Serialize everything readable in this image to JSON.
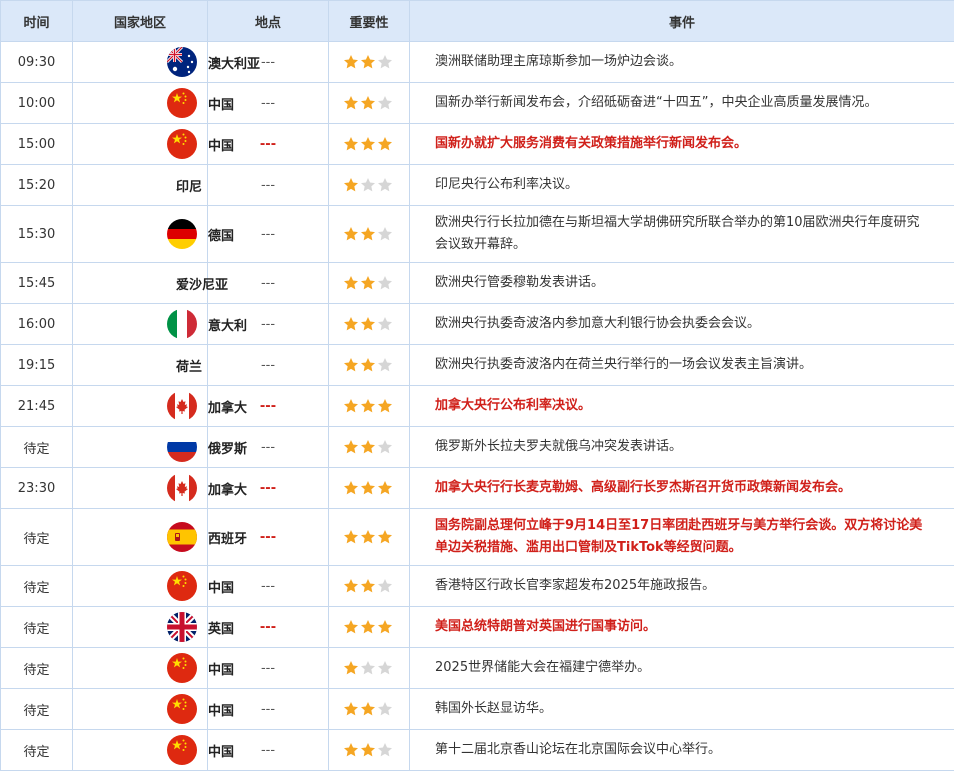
{
  "header": {
    "time": "时间",
    "country": "国家地区",
    "place": "地点",
    "importance": "重要性",
    "event": "事件"
  },
  "colors": {
    "header_bg": "#dbe8f9",
    "border": "#c6d8ee",
    "highlight": "#d0201a",
    "star_on": "#f5a623",
    "star_off": "#d6d6d6"
  },
  "rows": [
    {
      "time": "09:30",
      "flag": "australia-flag-icon",
      "country": "澳大利亚",
      "place": "---",
      "stars": 2,
      "highlight": false,
      "event": "澳洲联储助理主席琼斯参加一场炉边会谈。"
    },
    {
      "time": "10:00",
      "flag": "china-flag-icon",
      "country": "中国",
      "place": "---",
      "stars": 2,
      "highlight": false,
      "event": "国新办举行新闻发布会，介绍砥砺奋进“十四五”，中央企业高质量发展情况。"
    },
    {
      "time": "15:00",
      "flag": "china-flag-icon",
      "country": "中国",
      "place": "---",
      "stars": 3,
      "highlight": true,
      "event": "国新办就扩大服务消费有关政策措施举行新闻发布会。"
    },
    {
      "time": "15:20",
      "flag": "",
      "country": "印尼",
      "place": "---",
      "stars": 1,
      "highlight": false,
      "event": "印尼央行公布利率决议。"
    },
    {
      "time": "15:30",
      "flag": "germany-flag-icon",
      "country": "德国",
      "place": "---",
      "stars": 2,
      "highlight": false,
      "event": "欧洲央行行长拉加德在与斯坦福大学胡佛研究所联合举办的第10届欧洲央行年度研究会议致开幕辞。",
      "tall": true
    },
    {
      "time": "15:45",
      "flag": "",
      "country": "爱沙尼亚",
      "place": "---",
      "stars": 2,
      "highlight": false,
      "event": "欧洲央行管委穆勒发表讲话。"
    },
    {
      "time": "16:00",
      "flag": "italy-flag-icon",
      "country": "意大利",
      "place": "---",
      "stars": 2,
      "highlight": false,
      "event": "欧洲央行执委奇波洛内参加意大利银行协会执委会会议。"
    },
    {
      "time": "19:15",
      "flag": "",
      "country": "荷兰",
      "place": "---",
      "stars": 2,
      "highlight": false,
      "event": "欧洲央行执委奇波洛内在荷兰央行举行的一场会议发表主旨演讲。"
    },
    {
      "time": "21:45",
      "flag": "canada-flag-icon",
      "country": "加拿大",
      "place": "---",
      "stars": 3,
      "highlight": true,
      "event": "加拿大央行公布利率决议。"
    },
    {
      "time": "待定",
      "flag": "russia-flag-icon",
      "country": "俄罗斯",
      "place": "---",
      "stars": 2,
      "highlight": false,
      "event": "俄罗斯外长拉夫罗夫就俄乌冲突发表讲话。"
    },
    {
      "time": "23:30",
      "flag": "canada-flag-icon",
      "country": "加拿大",
      "place": "---",
      "stars": 3,
      "highlight": true,
      "event": "加拿大央行行长麦克勒姆、高级副行长罗杰斯召开货币政策新闻发布会。"
    },
    {
      "time": "待定",
      "flag": "spain-flag-icon",
      "country": "西班牙",
      "place": "---",
      "stars": 3,
      "highlight": true,
      "event": "国务院副总理何立峰于9月14日至17日率团赴西班牙与美方举行会谈。双方将讨论美单边关税措施、滥用出口管制及TikTok等经贸问题。",
      "tall": true
    },
    {
      "time": "待定",
      "flag": "china-flag-icon",
      "country": "中国",
      "place": "---",
      "stars": 2,
      "highlight": false,
      "event": "香港特区行政长官李家超发布2025年施政报告。"
    },
    {
      "time": "待定",
      "flag": "uk-flag-icon",
      "country": "英国",
      "place": "---",
      "stars": 3,
      "highlight": true,
      "event": "美国总统特朗普对英国进行国事访问。"
    },
    {
      "time": "待定",
      "flag": "china-flag-icon",
      "country": "中国",
      "place": "---",
      "stars": 1,
      "highlight": false,
      "event": "2025世界储能大会在福建宁德举办。"
    },
    {
      "time": "待定",
      "flag": "china-flag-icon",
      "country": "中国",
      "place": "---",
      "stars": 2,
      "highlight": false,
      "event": "韩国外长赵显访华。"
    },
    {
      "time": "待定",
      "flag": "china-flag-icon",
      "country": "中国",
      "place": "---",
      "stars": 2,
      "highlight": false,
      "event": "第十二届北京香山论坛在北京国际会议中心举行。"
    }
  ]
}
